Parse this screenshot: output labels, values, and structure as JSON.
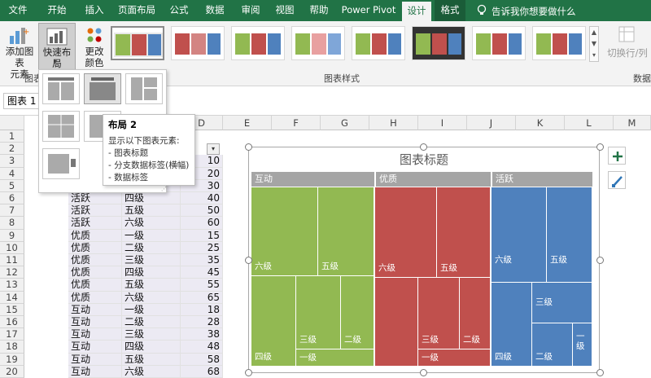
{
  "tabs": [
    "文件",
    "开始",
    "插入",
    "页面布局",
    "公式",
    "数据",
    "审阅",
    "视图",
    "帮助",
    "Power Pivot",
    "设计",
    "格式"
  ],
  "search_hint": "告诉我你想要做什么",
  "ribbon": {
    "add_element": "添加图表\n元素",
    "quick_layout": "快速布局",
    "change_color": "更改\n颜色",
    "group_layouts": "图表",
    "group_styles": "图表样式",
    "switch_rowcol": "切换行/列",
    "group_data": "数据"
  },
  "name_box": "图表 1",
  "tooltip": {
    "title": "布局 2",
    "intro": "显示以下图表元素:",
    "items": [
      "- 图表标题",
      "- 分支数据标签(横幅)",
      "- 数据标签"
    ]
  },
  "columns": [
    "D",
    "E",
    "F",
    "G",
    "H",
    "I",
    "J",
    "K",
    "L",
    "M"
  ],
  "rows": [
    "1",
    "2",
    "3",
    "4",
    "5",
    "6",
    "7",
    "8",
    "9",
    "10",
    "11",
    "12",
    "13",
    "14",
    "15",
    "16",
    "17",
    "18",
    "19",
    "20"
  ],
  "table": [
    {
      "a": "",
      "b": "",
      "c": "10"
    },
    {
      "a": "",
      "b": "",
      "c": "20"
    },
    {
      "a": "",
      "b": "",
      "c": "30"
    },
    {
      "a": "活跃",
      "b": "四级",
      "c": "40"
    },
    {
      "a": "活跃",
      "b": "五级",
      "c": "50"
    },
    {
      "a": "活跃",
      "b": "六级",
      "c": "60"
    },
    {
      "a": "优质",
      "b": "一级",
      "c": "15"
    },
    {
      "a": "优质",
      "b": "二级",
      "c": "25"
    },
    {
      "a": "优质",
      "b": "三级",
      "c": "35"
    },
    {
      "a": "优质",
      "b": "四级",
      "c": "45"
    },
    {
      "a": "优质",
      "b": "五级",
      "c": "55"
    },
    {
      "a": "优质",
      "b": "六级",
      "c": "65"
    },
    {
      "a": "互动",
      "b": "一级",
      "c": "18"
    },
    {
      "a": "互动",
      "b": "二级",
      "c": "28"
    },
    {
      "a": "互动",
      "b": "三级",
      "c": "38"
    },
    {
      "a": "互动",
      "b": "四级",
      "c": "48"
    },
    {
      "a": "互动",
      "b": "五级",
      "c": "58"
    },
    {
      "a": "互动",
      "b": "六级",
      "c": "68"
    }
  ],
  "chart": {
    "title": "图表标题",
    "branches": [
      "互动",
      "优质",
      "活跃"
    ],
    "labels": {
      "hudong": [
        "六级",
        "五级",
        "四级",
        "三级",
        "二级",
        "一级"
      ],
      "youzhi": [
        "六级",
        "五级",
        "三级",
        "二级",
        "一级"
      ],
      "huoyue": [
        "六级",
        "五级",
        "三级",
        "四级",
        "二级",
        "一级"
      ]
    }
  },
  "colors": {
    "excel_green": "#217346",
    "green": "#92b952",
    "red": "#c0504d",
    "blue": "#4f81bd",
    "banner": "#a5a5a5"
  }
}
